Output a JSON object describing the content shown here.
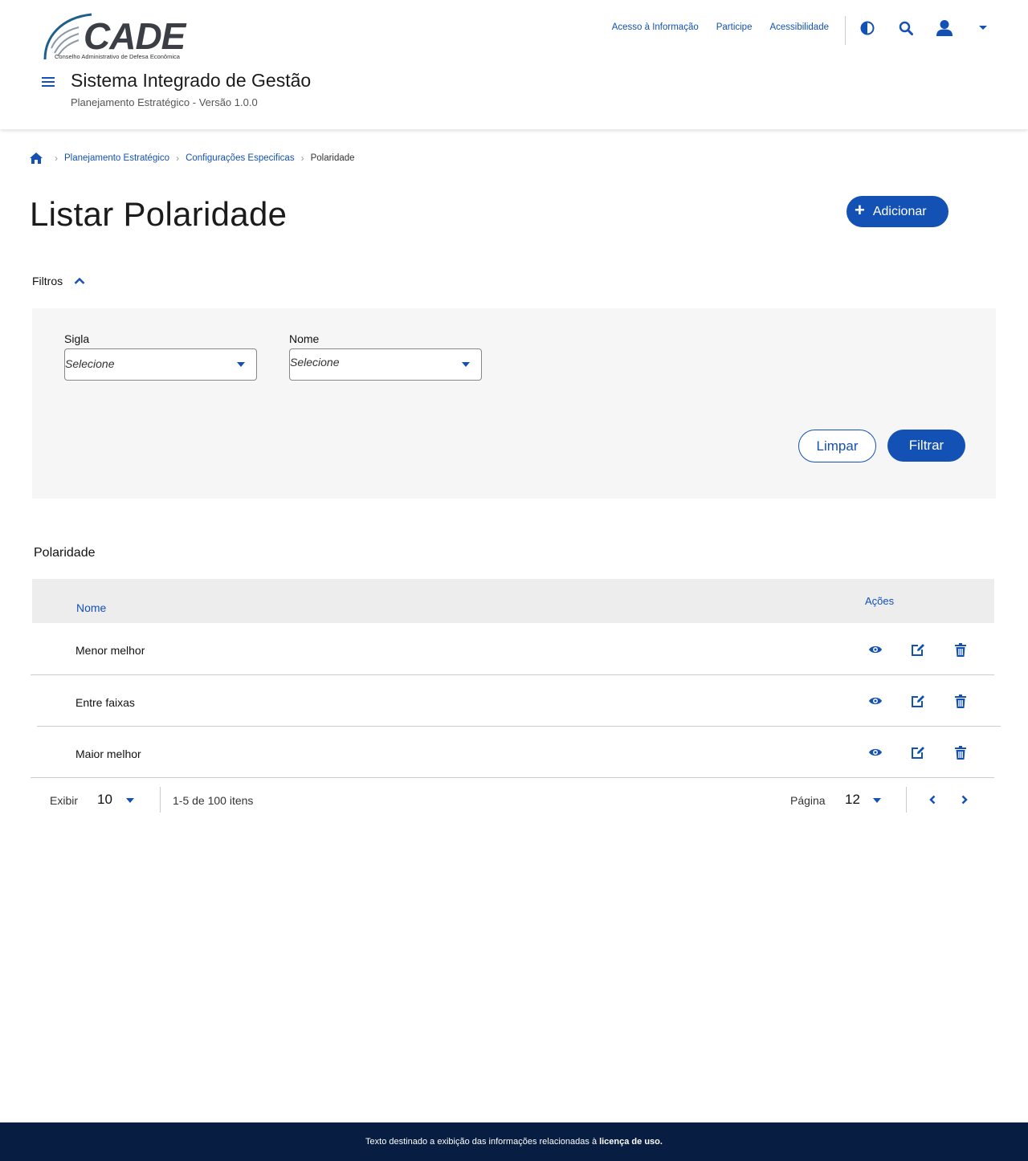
{
  "header": {
    "logo": {
      "wordmark": "CADE",
      "subtitle": "Conselho Administrativo de Defesa Econômica"
    },
    "links": [
      "Acesso à Informação",
      "Participe",
      "Acessibilidade"
    ],
    "icons": [
      "contrast-icon",
      "search-icon",
      "user-icon",
      "chevron-down-icon"
    ],
    "system_title": "Sistema Integrado de Gestão",
    "system_subtitle": "Planejamento Estratégico - Versão 1.0.0"
  },
  "breadcrumb": {
    "items": [
      "Planejamento Estratégico",
      "Configurações Especificas"
    ],
    "current": "Polaridade"
  },
  "page": {
    "title": "Listar Polaridade",
    "add_button": "Adicionar"
  },
  "filters": {
    "toggle_label": "Filtros",
    "fields": [
      {
        "label": "Sigla",
        "value": "Selecione"
      },
      {
        "label": "Nome",
        "value": "Selecione"
      }
    ],
    "clear_button": "Limpar",
    "filter_button": "Filtrar"
  },
  "table": {
    "title": "Polaridade",
    "headers": {
      "name": "Nome",
      "actions": "Ações"
    },
    "rows": [
      {
        "name": "Menor melhor"
      },
      {
        "name": "Entre faixas"
      },
      {
        "name": "Maior melhor"
      }
    ],
    "row_actions": [
      "eye-icon",
      "edit-icon",
      "trash-icon"
    ]
  },
  "pagination": {
    "show_label": "Exibir",
    "page_size": "10",
    "range_text": "1-5 de 100 itens",
    "page_label": "Página",
    "page_number": "12"
  },
  "footer": {
    "text": "Texto destinado a exibição das informações relacionadas à",
    "link": "licença de uso."
  },
  "colors": {
    "primary": "#1351b4",
    "footer_bg": "#071d41",
    "panel_bg": "#f6f6f6",
    "table_header_bg": "#ededed"
  }
}
